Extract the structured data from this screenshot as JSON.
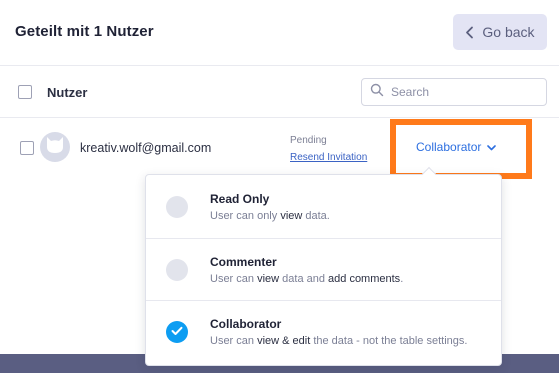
{
  "header": {
    "title": "Geteilt mit 1 Nutzer",
    "go_back_label": "Go back"
  },
  "table": {
    "column_user": "Nutzer",
    "search_placeholder": "Search"
  },
  "row": {
    "email": "kreativ.wolf@gmail.com",
    "status": "Pending",
    "resend_label": "Resend Invitation",
    "role_label": "Collaborator"
  },
  "menu": {
    "options": [
      {
        "title": "Read Only",
        "desc": [
          "User can only ",
          "view",
          " data."
        ],
        "selected": false
      },
      {
        "title": "Commenter",
        "desc": [
          "User can ",
          "view",
          " data and ",
          "add comments",
          "."
        ],
        "selected": false
      },
      {
        "title": "Collaborator",
        "desc": [
          "User can ",
          "view & edit",
          " the data - not the table settings."
        ],
        "selected": true
      }
    ]
  },
  "icons": {
    "back": "chevron-left-icon",
    "search": "search-icon",
    "dropdown": "chevron-down-icon",
    "check": "check-icon",
    "avatar": "cat-avatar-icon"
  },
  "colors": {
    "accent_blue": "#2d6fe0",
    "highlight_orange": "#ff7a1a",
    "checked_radio": "#0d9df2",
    "back_button_bg": "#e3e4f4",
    "footer_bar": "#5a5e82"
  }
}
